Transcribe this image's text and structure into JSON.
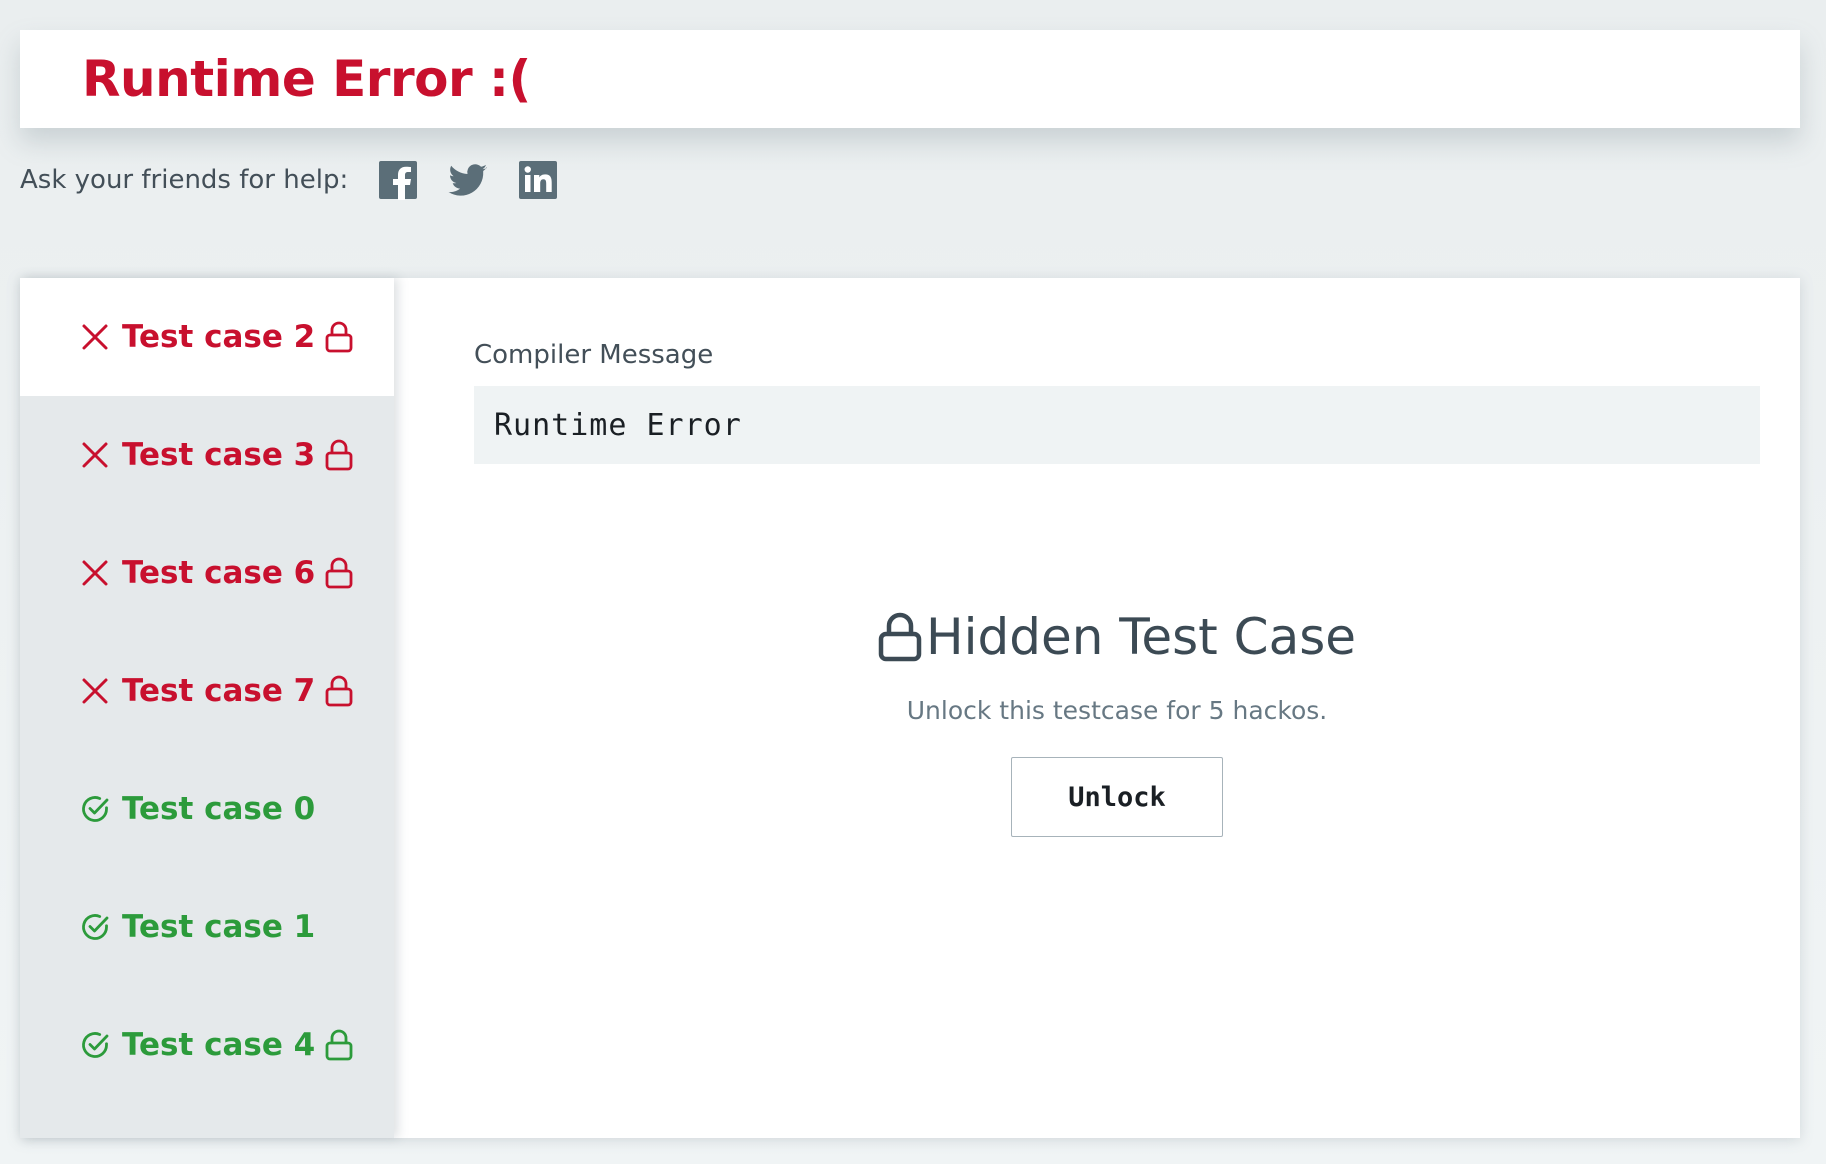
{
  "header": {
    "title": "Runtime Error :("
  },
  "share": {
    "label": "Ask your friends for help:",
    "icons": [
      "facebook-icon",
      "twitter-icon",
      "linkedin-icon"
    ],
    "icon_color": "#5b6e78"
  },
  "colors": {
    "fail": "#c8102e",
    "pass": "#2c9b3b"
  },
  "tabs": [
    {
      "label": "Test case 2",
      "status": "fail",
      "locked": true,
      "active": true
    },
    {
      "label": "Test case 3",
      "status": "fail",
      "locked": true
    },
    {
      "label": "Test case 6",
      "status": "fail",
      "locked": true
    },
    {
      "label": "Test case 7",
      "status": "fail",
      "locked": true
    },
    {
      "label": "Test case 0",
      "status": "pass",
      "locked": false
    },
    {
      "label": "Test case 1",
      "status": "pass",
      "locked": false
    },
    {
      "label": "Test case 4",
      "status": "pass",
      "locked": true
    }
  ],
  "compiler": {
    "title": "Compiler Message",
    "message": "Runtime Error"
  },
  "hidden": {
    "title": "Hidden Test Case",
    "subtitle": "Unlock this testcase for 5 hackos.",
    "button": "Unlock"
  }
}
